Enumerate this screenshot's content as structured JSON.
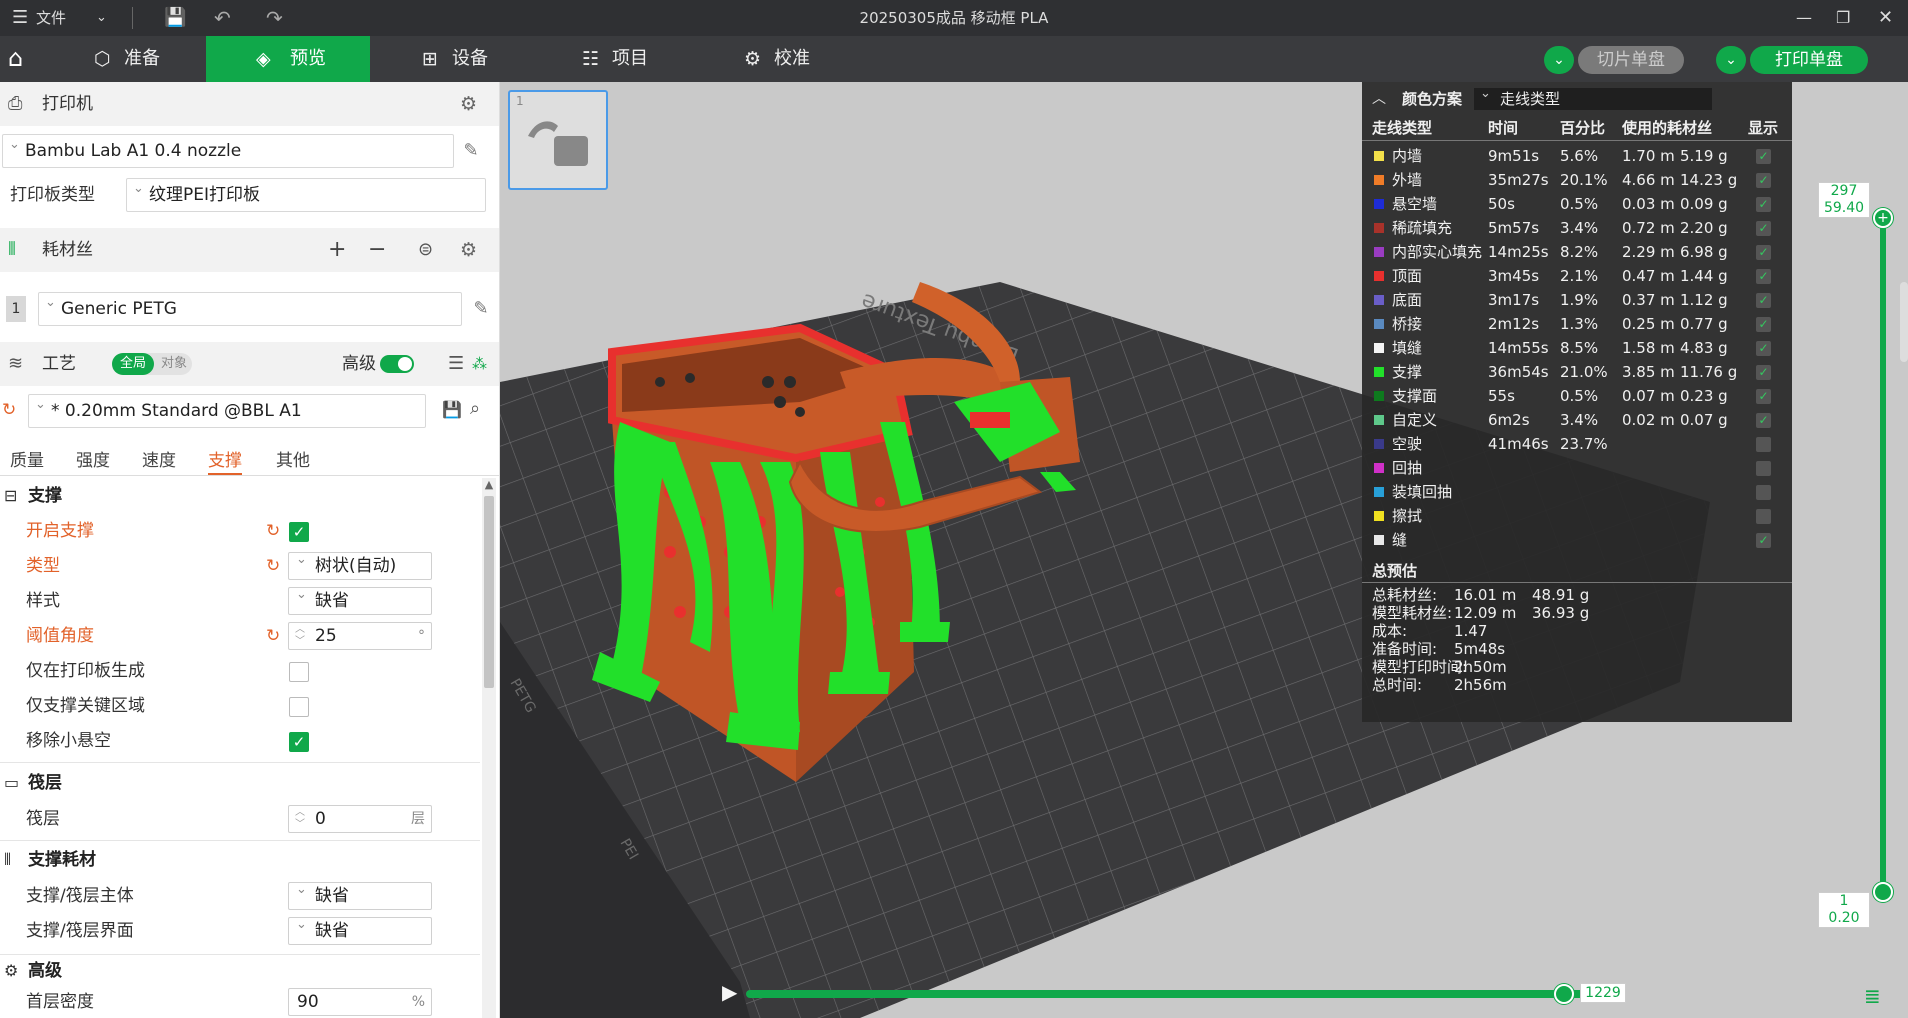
{
  "titlebar": {
    "menu_label": "文件",
    "title": "20250305成品 移动框 PLA"
  },
  "nav": {
    "tabs": [
      {
        "label": "准备",
        "icon": "cube-icon"
      },
      {
        "label": "预览",
        "icon": "layers-icon"
      },
      {
        "label": "设备",
        "icon": "device-icon"
      },
      {
        "label": "项目",
        "icon": "list-icon"
      },
      {
        "label": "校准",
        "icon": "gear-icon"
      }
    ],
    "slice_plate": "切片单盘",
    "print_plate": "打印单盘"
  },
  "left": {
    "printer_section": "打印机",
    "printer": "Bambu Lab A1 0.4 nozzle",
    "plate_type_label": "打印板类型",
    "plate_type": "纹理PEI打印板",
    "filament_section": "耗材丝",
    "filament_index": "1",
    "filament": "Generic PETG",
    "process_section": "工艺",
    "toggle_global": "全局",
    "toggle_object": "对象",
    "advanced_label": "高级",
    "process_preset": "* 0.20mm Standard @BBL A1",
    "subtabs": [
      "质量",
      "强度",
      "速度",
      "支撑",
      "其他"
    ],
    "groups": {
      "support": "支撑",
      "raft": "筏层",
      "support_filament": "支撑耗材",
      "advanced": "高级"
    },
    "rows": {
      "enable_support": "开启支撑",
      "type_label": "类型",
      "type_value": "树状(自动)",
      "style_label": "样式",
      "style_value": "缺省",
      "threshold_label": "阈值角度",
      "threshold_value": "25",
      "threshold_unit": "°",
      "on_plate_only": "仅在打印板生成",
      "critical_only": "仅支撑关键区域",
      "remove_small": "移除小悬空",
      "raft_label": "筏层",
      "raft_value": "0",
      "raft_unit": "层",
      "support_base_label": "支撑/筏层主体",
      "support_base_value": "缺省",
      "support_iface_label": "支撑/筏层界面",
      "support_iface_value": "缺省",
      "first_layer_density_label": "首层密度",
      "first_layer_density_value": "90",
      "first_layer_density_unit": "%"
    }
  },
  "viewport": {
    "thumb_index": "1",
    "bed_brand": "Bambu Texture",
    "bed_text_a": "PETG",
    "bed_text_b": "PEI",
    "layer_top": "297",
    "height_top": "59.40",
    "layer_bottom": "1",
    "height_bottom": "0.20",
    "move_value": "1229"
  },
  "legend": {
    "scheme_label": "颜色方案",
    "scheme_value": "走线类型",
    "headers": [
      "走线类型",
      "时间",
      "百分比",
      "使用的耗材丝",
      "显示"
    ],
    "rows": [
      {
        "name": "内墙",
        "time": "9m51s",
        "pct": "5.6%",
        "len": "1.70 m",
        "wt": "5.19 g",
        "color": "#f3e04a",
        "shown": true
      },
      {
        "name": "外墙",
        "time": "35m27s",
        "pct": "20.1%",
        "len": "4.66 m",
        "wt": "14.23 g",
        "color": "#f07c28",
        "shown": true
      },
      {
        "name": "悬空墙",
        "time": "50s",
        "pct": "0.5%",
        "len": "0.03 m",
        "wt": "0.09 g",
        "color": "#1e2cd6",
        "shown": true
      },
      {
        "name": "稀疏填充",
        "time": "5m57s",
        "pct": "3.4%",
        "len": "0.72 m",
        "wt": "2.20 g",
        "color": "#a8322a",
        "shown": true
      },
      {
        "name": "内部实心填充",
        "time": "14m25s",
        "pct": "8.2%",
        "len": "2.29 m",
        "wt": "6.98 g",
        "color": "#9a3cc2",
        "shown": true
      },
      {
        "name": "顶面",
        "time": "3m45s",
        "pct": "2.1%",
        "len": "0.47 m",
        "wt": "1.44 g",
        "color": "#e8302e",
        "shown": true
      },
      {
        "name": "底面",
        "time": "3m17s",
        "pct": "1.9%",
        "len": "0.37 m",
        "wt": "1.12 g",
        "color": "#6a5ec8",
        "shown": true
      },
      {
        "name": "桥接",
        "time": "2m12s",
        "pct": "1.3%",
        "len": "0.25 m",
        "wt": "0.77 g",
        "color": "#5a8ac0",
        "shown": true
      },
      {
        "name": "填缝",
        "time": "14m55s",
        "pct": "8.5%",
        "len": "1.58 m",
        "wt": "4.83 g",
        "color": "#f4f4f4",
        "shown": true
      },
      {
        "name": "支撑",
        "time": "36m54s",
        "pct": "21.0%",
        "len": "3.85 m",
        "wt": "11.76 g",
        "color": "#22e02a",
        "shown": true
      },
      {
        "name": "支撑面",
        "time": "55s",
        "pct": "0.5%",
        "len": "0.07 m",
        "wt": "0.23 g",
        "color": "#0e7a1e",
        "shown": true
      },
      {
        "name": "自定义",
        "time": "6m2s",
        "pct": "3.4%",
        "len": "0.02 m",
        "wt": "0.07 g",
        "color": "#5ec88a",
        "shown": true
      },
      {
        "name": "空驶",
        "time": "41m46s",
        "pct": "23.7%",
        "len": "",
        "wt": "",
        "color": "#3a3a8a",
        "shown": false
      },
      {
        "name": "回抽",
        "time": "",
        "pct": "",
        "len": "",
        "wt": "",
        "color": "#d030c8",
        "shown": false
      },
      {
        "name": "装填回抽",
        "time": "",
        "pct": "",
        "len": "",
        "wt": "",
        "color": "#28a0d8",
        "shown": false
      },
      {
        "name": "擦拭",
        "time": "",
        "pct": "",
        "len": "",
        "wt": "",
        "color": "#f0e020",
        "shown": false
      },
      {
        "name": "缝",
        "time": "",
        "pct": "",
        "len": "",
        "wt": "",
        "color": "#e8e8e8",
        "shown": true
      }
    ],
    "summary_title": "总预估",
    "summary": [
      {
        "label": "总耗材丝:",
        "v1": "16.01 m",
        "v2": "48.91 g"
      },
      {
        "label": "模型耗材丝:",
        "v1": "12.09 m",
        "v2": "36.93 g"
      },
      {
        "label": "成本:",
        "v1": "1.47",
        "v2": ""
      },
      {
        "label": "准备时间:",
        "v1": "5m48s",
        "v2": ""
      },
      {
        "label": "模型打印时间:",
        "v1": "2h50m",
        "v2": ""
      },
      {
        "label": "总时间:",
        "v1": "2h56m",
        "v2": ""
      }
    ]
  },
  "colors": {
    "accent": "#10a84a",
    "part": "#d0612a",
    "support": "#22e02a",
    "bed": "#3c3c3e"
  }
}
